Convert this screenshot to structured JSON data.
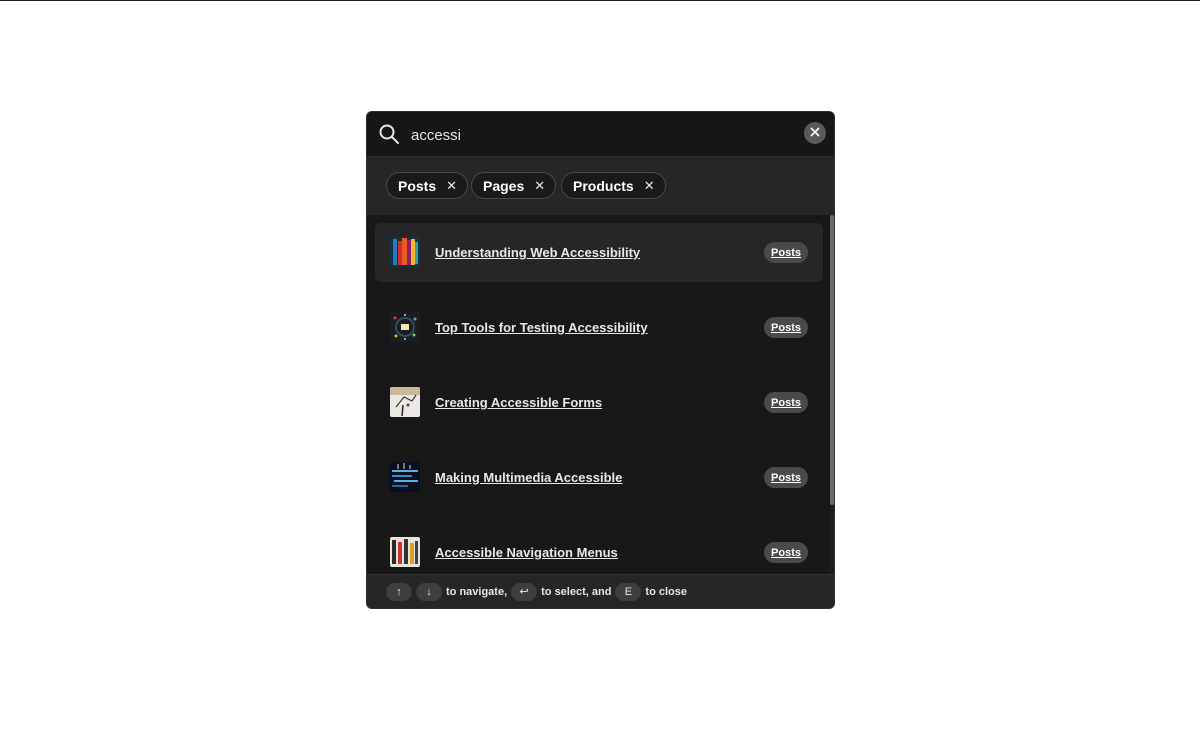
{
  "search": {
    "value": "accessi",
    "placeholder": "Search"
  },
  "filters": [
    {
      "label": "Posts"
    },
    {
      "label": "Pages"
    },
    {
      "label": "Products"
    }
  ],
  "chip_close_glyph": "✕",
  "results": [
    {
      "title": "Understanding Web Accessibility",
      "badge": "Posts",
      "active": true
    },
    {
      "title": "Top Tools for Testing Accessibility",
      "badge": "Posts",
      "active": false
    },
    {
      "title": "Creating Accessible Forms",
      "badge": "Posts",
      "active": false
    },
    {
      "title": "Making Multimedia Accessible",
      "badge": "Posts",
      "active": false
    },
    {
      "title": "Accessible Navigation Menus",
      "badge": "Posts",
      "active": false
    }
  ],
  "footer": {
    "key_up": "↑",
    "key_down": "↓",
    "text_navigate": "to navigate,",
    "key_enter": "↩",
    "text_select": "to select, and",
    "key_close": "E",
    "text_close": "to close"
  },
  "colors": {
    "modal_bg": "#181818",
    "filter_bar_bg": "#262626",
    "badge_bg": "#4a4a4a"
  }
}
